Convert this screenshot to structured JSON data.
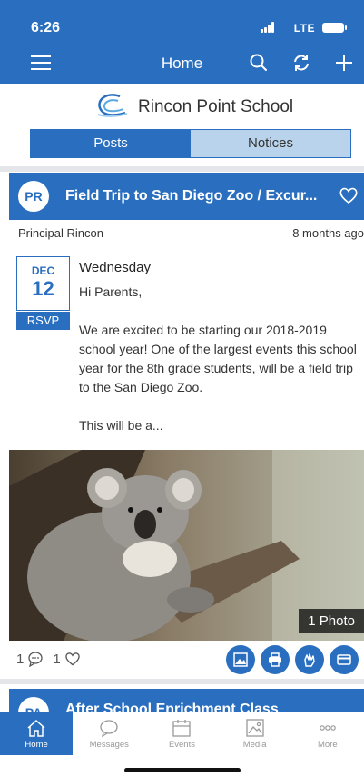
{
  "status_bar": {
    "time": "6:26",
    "network": "LTE"
  },
  "nav": {
    "title": "Home"
  },
  "school": {
    "name": "Rincon Point School"
  },
  "segments": {
    "posts": "Posts",
    "notices": "Notices"
  },
  "post": {
    "avatar_initials": "PR",
    "title": "Field Trip to San Diego Zoo  / Excur...",
    "author": "Principal Rincon",
    "time_ago": "8 months ago",
    "date": {
      "month": "DEC",
      "day": "12",
      "rsvp": "RSVP"
    },
    "weekday": "Wednesday",
    "greeting": "Hi Parents,",
    "paragraph": "We are excited to be starting our 2018-2019 school year! One of the largest events this school year for the 8th grade students, will be a field trip to the San Diego Zoo.",
    "teaser": "This will be a...",
    "photo_label": "1 Photo",
    "comment_count": "1",
    "like_count": "1"
  },
  "next_post": {
    "avatar_initials": "PA",
    "title": "After School Enrichment Class"
  },
  "tabbar": {
    "home": "Home",
    "messages": "Messages",
    "events": "Events",
    "media": "Media",
    "more": "More"
  },
  "colors": {
    "primary": "#2a6fbf",
    "segment_off": "#b9d3ec",
    "divider": "#e4e6ea"
  },
  "icons": [
    "menu-icon",
    "search-icon",
    "refresh-icon",
    "plus-icon",
    "heart-icon",
    "comment-icon",
    "image-icon",
    "print-icon",
    "hand-icon",
    "card-icon",
    "home-icon",
    "messages-icon",
    "events-icon",
    "media-icon",
    "more-icon"
  ]
}
